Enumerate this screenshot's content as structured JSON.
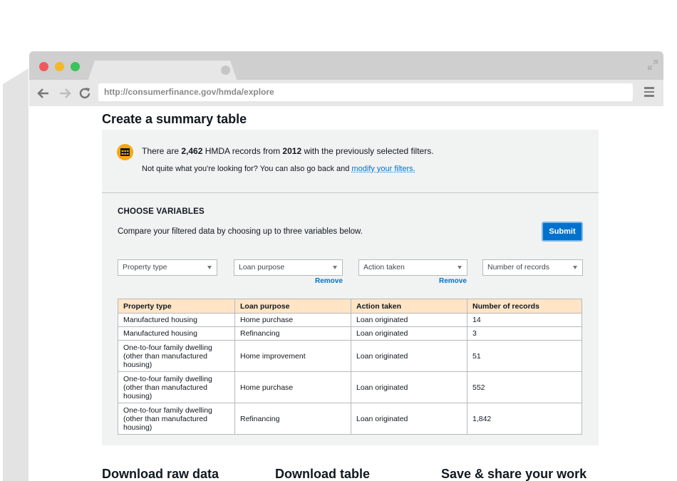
{
  "browser": {
    "url": "http://consumerfinance.gov/hmda/explore"
  },
  "page": {
    "title": "Create a summary table",
    "info": {
      "text_before_count": "There are ",
      "record_count": "2,462",
      "text_after_count": " HMDA records from ",
      "year": "2012",
      "text_after_year": " with the previously selected filters.",
      "line2_text": "Not quite what you're looking for? You can also go back and ",
      "modify_link": "modify your filters."
    },
    "choose_variables": {
      "heading": "CHOOSE VARIABLES",
      "description": "Compare your filtered data by choosing up to three variables below.",
      "submit_label": "Submit",
      "selects": [
        "Property type",
        "Loan purpose",
        "Action taken",
        "Number of records"
      ],
      "remove_label": "Remove"
    },
    "table": {
      "headers": [
        "Property type",
        "Loan purpose",
        "Action taken",
        "Number of records"
      ],
      "rows": [
        [
          "Manufactured housing",
          "Home purchase",
          "Loan originated",
          "14"
        ],
        [
          "Manufactured housing",
          "Refinancing",
          "Loan originated",
          "3"
        ],
        [
          "One-to-four family dwelling\n(other than manufactured\nhousing)",
          "Home improvement",
          "Loan originated",
          "51"
        ],
        [
          "One-to-four family dwelling\n(other than manufactured\nhousing)",
          "Home purchase",
          "Loan originated",
          "552"
        ],
        [
          "One-to-four family dwelling\n(other than manufactured\nhousing)",
          "Refinancing",
          "Loan originated",
          "1,842"
        ]
      ]
    },
    "bottom_sections": [
      "Download raw data",
      "Download table",
      "Save & share your work"
    ]
  },
  "colors": {
    "accent_blue": "#0072ce",
    "table_header_bg": "#ffe5c6",
    "icon_orange": "#f6a810",
    "panel_bg": "#f1f2f2"
  }
}
